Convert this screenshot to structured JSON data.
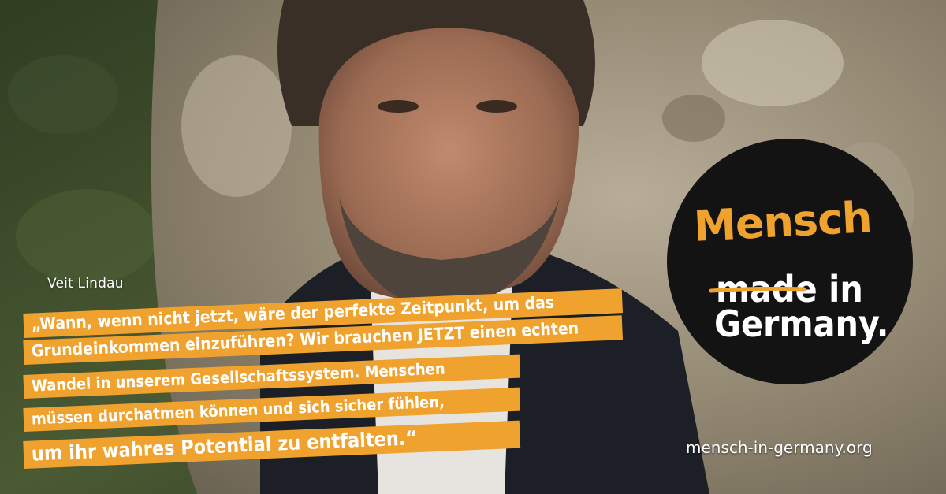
{
  "caption": {
    "name": "Veit Lindau"
  },
  "quote": {
    "line1": "„Wann, wenn nicht jetzt, wäre der perfekte Zeitpunkt, um das",
    "line2": "Grundeinkommen einzuführen? Wir brauchen JETZT einen echten",
    "line3": "Wandel in unserem Gesellschaftssystem. Menschen",
    "line4": "müssen durchatmen können und sich sicher fühlen,",
    "line5": "um ihr wahres Potential zu entfalten.“"
  },
  "logo": {
    "word1": "Mensch",
    "word2": "made in",
    "word3": "Germany."
  },
  "footer": {
    "url": "mensch-in-germany.org"
  },
  "colors": {
    "accent": "#f0a22e",
    "badge": "#131313",
    "text": "#ffffff"
  },
  "icons": {
    "photo": "portrait-photo",
    "strike": "brush-strike-icon"
  }
}
